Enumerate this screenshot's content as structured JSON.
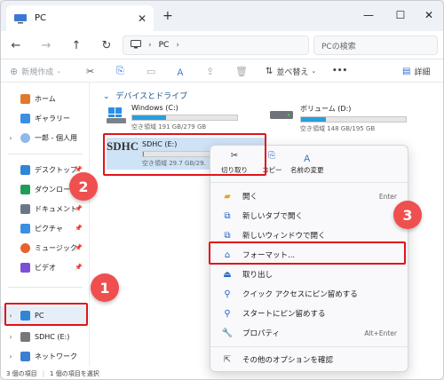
{
  "tab": {
    "title": "PC",
    "close": "✕"
  },
  "new_tab": "+",
  "window_controls": {
    "minimize": "—",
    "maximize": "☐",
    "close": "✕"
  },
  "nav": {
    "back": "←",
    "forward": "→",
    "up": "↑",
    "refresh": "↻"
  },
  "path": {
    "segment": "PC",
    "sep": "›"
  },
  "search": {
    "placeholder": "PCの検索"
  },
  "toolbar": {
    "new": "新規作成",
    "sort": "並べ替え",
    "more": "•••",
    "details": "詳細"
  },
  "sidebar": {
    "items": [
      {
        "label": "ホーム",
        "icon": "home-icon"
      },
      {
        "label": "ギャラリー",
        "icon": "gallery-icon"
      },
      {
        "label": "一郎 - 個人用",
        "icon": "cloud-icon"
      },
      {
        "label": "デスクトップ",
        "icon": "desktop-icon"
      },
      {
        "label": "ダウンロード",
        "icon": "download-icon"
      },
      {
        "label": "ドキュメント",
        "icon": "document-icon"
      },
      {
        "label": "ピクチャ",
        "icon": "picture-icon"
      },
      {
        "label": "ミュージック",
        "icon": "music-icon"
      },
      {
        "label": "ビデオ",
        "icon": "video-icon"
      },
      {
        "label": "PC",
        "icon": "pc-icon"
      },
      {
        "label": "SDHC (E:)",
        "icon": "sdcard-icon"
      },
      {
        "label": "ネットワーク",
        "icon": "network-icon"
      }
    ],
    "pin": "📌"
  },
  "section": {
    "title": "デバイスとドライブ"
  },
  "drives": [
    {
      "name": "Windows (C:)",
      "free": "空き領域 191 GB/279 GB",
      "used_fraction": 0.32
    },
    {
      "name": "ボリューム (D:)",
      "free": "空き領域 148 GB/195 GB",
      "used_fraction": 0.24
    },
    {
      "name": "SDHC (E:)",
      "free": "空き領域 29.7 GB/29.",
      "used_fraction": 0.01
    }
  ],
  "sd_logo": "SDHC",
  "context_menu": {
    "top": [
      {
        "label": "切り取り",
        "icon": "✂"
      },
      {
        "label": "コピー",
        "icon": "⎘"
      },
      {
        "label": "名前の変更",
        "icon": "Ａ"
      }
    ],
    "items": [
      {
        "label": "開く",
        "shortcut": "Enter",
        "icon": "▰"
      },
      {
        "label": "新しいタブで開く",
        "shortcut": "",
        "icon": "⧉"
      },
      {
        "label": "新しいウィンドウで開く",
        "shortcut": "",
        "icon": "⧉"
      },
      {
        "label": "フォーマット...",
        "shortcut": "",
        "icon": "⌂"
      },
      {
        "label": "取り出し",
        "shortcut": "",
        "icon": "⏏"
      },
      {
        "label": "クイック アクセスにピン留めする",
        "shortcut": "",
        "icon": "⚲"
      },
      {
        "label": "スタートにピン留めする",
        "shortcut": "",
        "icon": "⚲"
      },
      {
        "label": "プロパティ",
        "shortcut": "Alt+Enter",
        "icon": "🔧"
      },
      {
        "label": "その他のオプションを確認",
        "shortcut": "",
        "icon": "⇱"
      }
    ]
  },
  "status": {
    "count": "3 個の項目",
    "selected": "1 個の項目を選択"
  },
  "badges": [
    "1",
    "2",
    "3"
  ],
  "colors": {
    "accent": "#26a0da",
    "highlight": "#e0141b",
    "badge": "#ef4f4f"
  }
}
